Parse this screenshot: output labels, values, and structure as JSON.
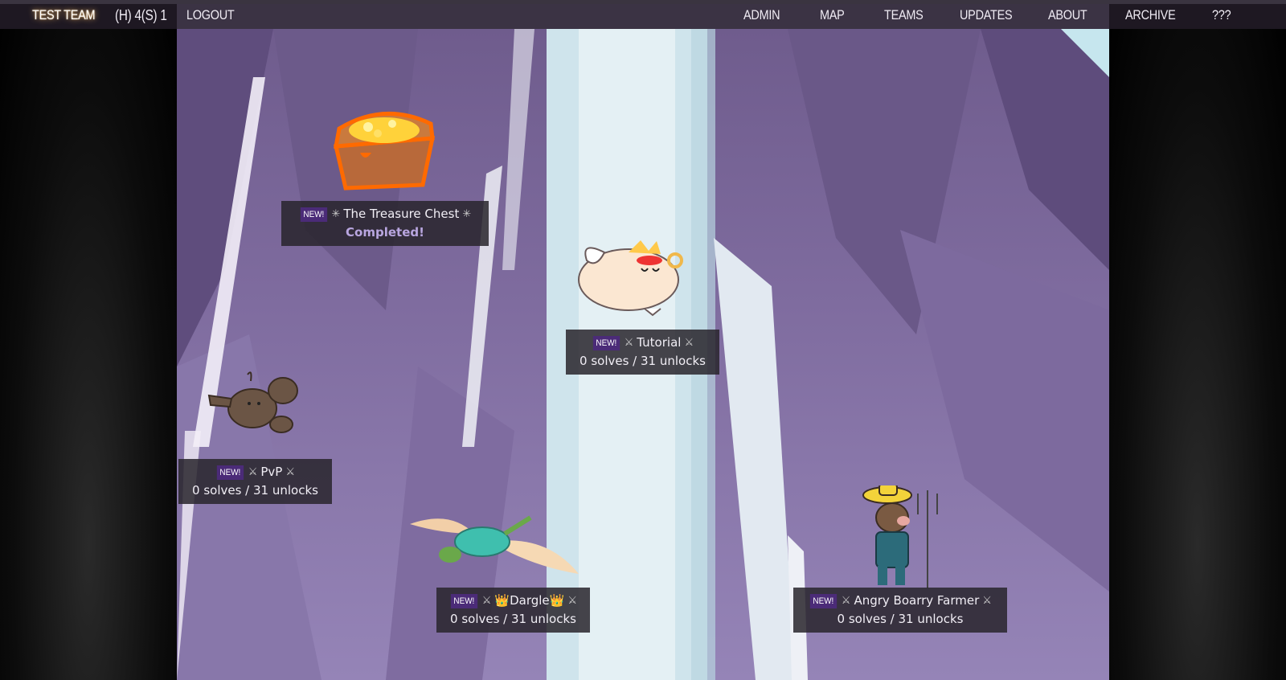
{
  "nav": {
    "team_name": "TEST TEAM",
    "score": "(H) 4(S) 1",
    "logout": "LOGOUT",
    "items": [
      "ADMIN",
      "MAP",
      "TEAMS",
      "UPDATES",
      "ABOUT",
      "ARCHIVE",
      "???"
    ]
  },
  "badge_text": "NEW!",
  "puzzles": [
    {
      "title": "The Treasure Chest",
      "icon": "dizzy-icon",
      "status": "Completed!"
    },
    {
      "title": "Tutorial",
      "icon": "crossed-swords-icon",
      "status": "0 solves / 31 unlocks"
    },
    {
      "title": "PvP",
      "icon": "crossed-swords-icon",
      "status": "0 solves / 31 unlocks"
    },
    {
      "title": "👑Dargle👑",
      "icon": "crossed-swords-icon",
      "status": "0 solves / 31 unlocks"
    },
    {
      "title": "Angry Boarry Farmer",
      "icon": "crossed-swords-icon",
      "status": "0 solves / 31 unlocks"
    }
  ],
  "colors": {
    "badge": "#4b2b78",
    "completed": "#b9a6e0",
    "label_bg": "#28242c"
  }
}
